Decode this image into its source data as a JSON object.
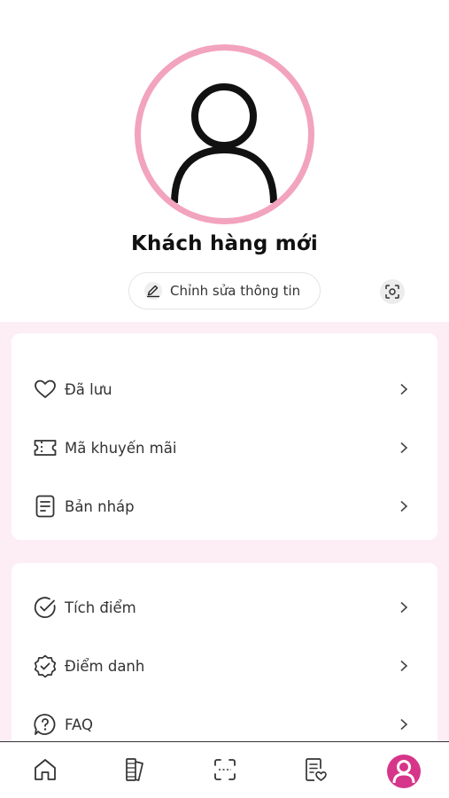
{
  "profile": {
    "name": "Khách hàng mới",
    "edit_label": "Chỉnh sửa thông tin",
    "avatar_icon": "user-avatar-icon",
    "ring_color": "#f2a3bd"
  },
  "menu_groups": [
    {
      "items": [
        {
          "label": "Đã lưu",
          "icon": "heart-icon"
        },
        {
          "label": "Mã khuyến mãi",
          "icon": "ticket-icon"
        },
        {
          "label": "Bản nháp",
          "icon": "document-icon"
        }
      ]
    },
    {
      "items": [
        {
          "label": "Tích điểm",
          "icon": "check-circle-icon"
        },
        {
          "label": "Điểm danh",
          "icon": "badge-check-icon"
        },
        {
          "label": "FAQ",
          "icon": "question-bubble-icon"
        }
      ]
    }
  ],
  "bottom_nav": {
    "items": [
      "home-icon",
      "catalog-icon",
      "scan-icon",
      "orders-icon",
      "profile-icon"
    ],
    "active": "profile-icon",
    "accent": "#d6358a"
  },
  "colors": {
    "menu_background": "#fdeef5",
    "card_background": "#ffffff"
  }
}
